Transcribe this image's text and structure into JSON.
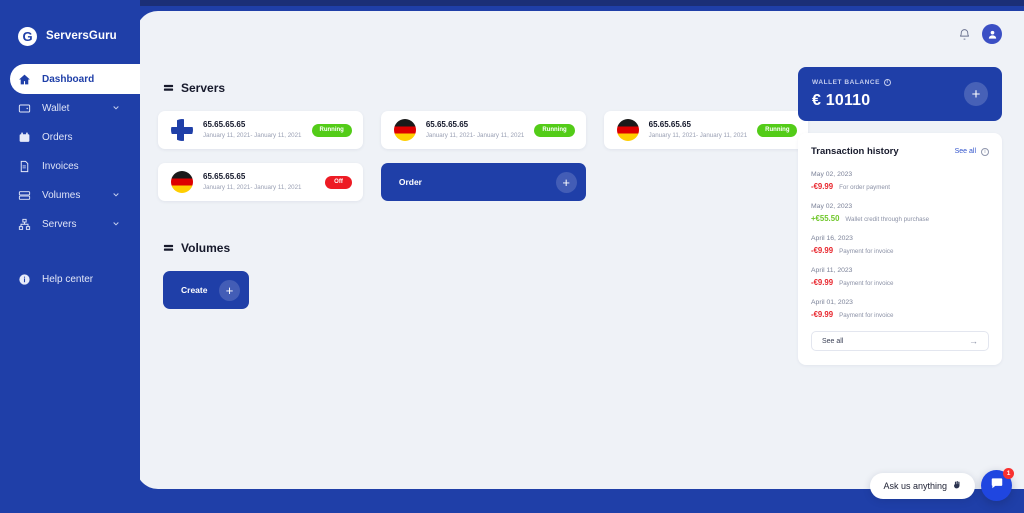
{
  "brand": {
    "logo_letter": "G",
    "name": "ServersGuru"
  },
  "sidebar": {
    "items": [
      {
        "label": "Dashboard",
        "icon": "home-icon",
        "active": true,
        "chevron": false
      },
      {
        "label": "Wallet",
        "icon": "wallet-icon",
        "active": false,
        "chevron": true
      },
      {
        "label": "Orders",
        "icon": "orders-icon",
        "active": false,
        "chevron": false
      },
      {
        "label": "Invoices",
        "icon": "invoice-icon",
        "active": false,
        "chevron": false
      },
      {
        "label": "Volumes",
        "icon": "volumes-icon",
        "active": false,
        "chevron": true
      },
      {
        "label": "Servers",
        "icon": "servers-icon",
        "active": false,
        "chevron": true
      }
    ],
    "help": {
      "label": "Help center",
      "icon": "info-icon"
    }
  },
  "header": {
    "notification_icon": "bell-icon",
    "avatar_icon": "user-avatar-icon"
  },
  "servers": {
    "title": "Servers",
    "cards": [
      {
        "flag": "fi",
        "ip": "65.65.65.65",
        "dates": "January 11, 2021- January 11, 2021",
        "status": "Running",
        "status_type": "running"
      },
      {
        "flag": "de",
        "ip": "65.65.65.65",
        "dates": "January 11, 2021- January 11, 2021",
        "status": "Running",
        "status_type": "running"
      },
      {
        "flag": "de",
        "ip": "65.65.65.65",
        "dates": "January 11, 2021- January 11, 2021",
        "status": "Running",
        "status_type": "running"
      },
      {
        "flag": "de",
        "ip": "65.65.65.65",
        "dates": "January 11, 2021- January 11, 2021",
        "status": "Off",
        "status_type": "off"
      }
    ],
    "order_button": {
      "label": "Order",
      "plus": "+"
    }
  },
  "volumes": {
    "title": "Volumes",
    "create_button": {
      "label": "Create",
      "plus": "+"
    }
  },
  "wallet": {
    "label": "WALLET BALANCE",
    "info_icon": "info-icon",
    "amount": "€ 10110",
    "add_plus": "+"
  },
  "transactions": {
    "title": "Transaction history",
    "see_all_link": "See all",
    "info_icon": "info-icon",
    "items": [
      {
        "date": "May 02, 2023",
        "amount": "-€9.99",
        "sign": "neg",
        "desc": "For order payment"
      },
      {
        "date": "May 02, 2023",
        "amount": "+€55.50",
        "sign": "pos",
        "desc": "Wallet credit through purchase"
      },
      {
        "date": "April 16, 2023",
        "amount": "-€9.99",
        "sign": "neg",
        "desc": "Payment for invoice"
      },
      {
        "date": "April 11, 2023",
        "amount": "-€9.99",
        "sign": "neg",
        "desc": "Payment for invoice"
      },
      {
        "date": "April 01, 2023",
        "amount": "-€9.99",
        "sign": "neg",
        "desc": "Payment for invoice"
      }
    ],
    "see_all_button": {
      "label": "See all",
      "arrow": "→"
    }
  },
  "chat": {
    "prompt": "Ask us anything",
    "emoji_icon": "wave-hand-icon",
    "fab_icon": "chat-bubble-icon",
    "badge": "1"
  },
  "colors": {
    "brand_blue": "#1f3fa8",
    "page_bg": "#eff2f7",
    "running_green": "#53cc18",
    "off_red": "#ed1b24",
    "credit_green": "#6fc72a",
    "debit_red": "#e8262d",
    "link_blue": "#3355cc"
  }
}
